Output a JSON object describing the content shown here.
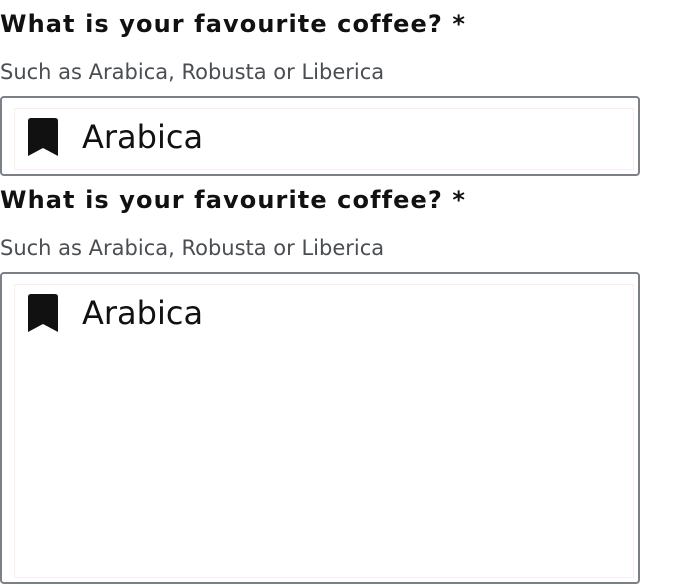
{
  "fields": [
    {
      "label": "What is your favourite coffee? *",
      "hint": "Such as Arabica, Robusta or Liberica",
      "value": "Arabica",
      "icon": "bookmark-icon",
      "control": "input"
    },
    {
      "label": "What is your favourite coffee? *",
      "hint": "Such as Arabica, Robusta or Liberica",
      "value": "Arabica",
      "icon": "bookmark-icon",
      "control": "textarea"
    }
  ],
  "colors": {
    "text": "#111111",
    "hint": "#4a4d52",
    "border": "#7b8087",
    "icon": "#111111"
  }
}
